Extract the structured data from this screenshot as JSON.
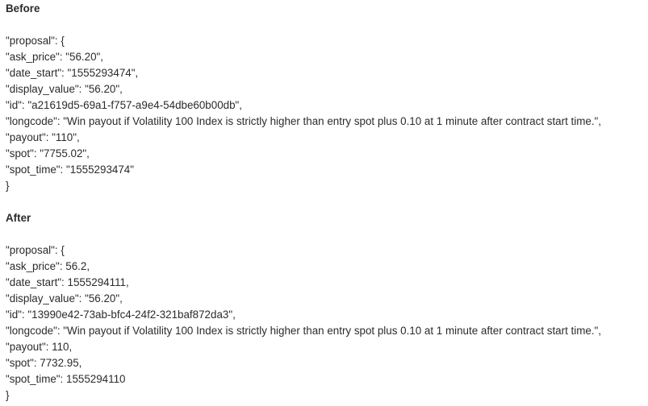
{
  "before": {
    "heading": "Before",
    "lines": [
      "\"proposal\": {",
      "\"ask_price\": \"56.20\",",
      "\"date_start\": \"1555293474\",",
      "\"display_value\": \"56.20\",",
      "\"id\": \"a21619d5-69a1-f757-a9e4-54dbe60b00db\",",
      "\"longcode\": \"Win payout if Volatility 100 Index is strictly higher than entry spot plus 0.10 at 1 minute after contract start time.\",",
      "\"payout\": \"110\",",
      "\"spot\": \"7755.02\",",
      "\"spot_time\": \"1555293474\"",
      "}"
    ]
  },
  "after": {
    "heading": "After",
    "lines": [
      "\"proposal\": {",
      "\"ask_price\": 56.2,",
      "\"date_start\": 1555294111,",
      "\"display_value\": \"56.20\",",
      "\"id\": \"13990e42-73ab-bfc4-24f2-321baf872da3\",",
      "\"longcode\": \"Win payout if Volatility 100 Index is strictly higher than entry spot plus 0.10 at 1 minute after contract start time.\",",
      "\"payout\": 110,",
      "\"spot\": 7732.95,",
      "\"spot_time\": 1555294110",
      "}"
    ]
  }
}
